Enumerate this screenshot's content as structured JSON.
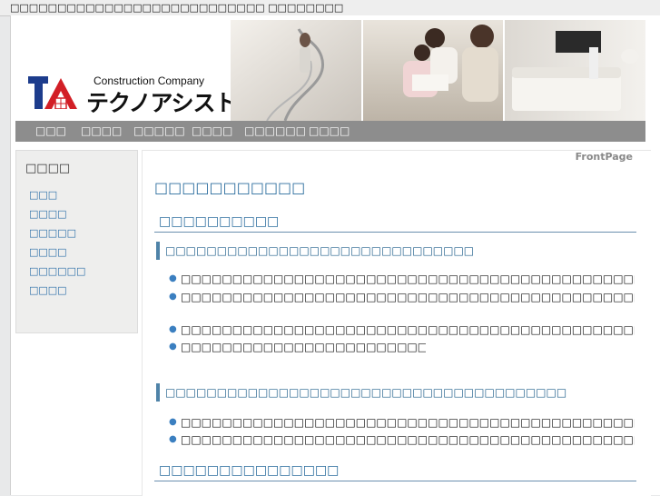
{
  "window": {
    "title": "□□□□□□□□□□□□□□□□□□□□□□□□□□□ □□□□□□□□"
  },
  "header": {
    "logo_en": "Construction Company",
    "logo_jp": "テクノアシスト",
    "colors": {
      "nav_bg": "#8d8d8d",
      "link": "#2a6ea8",
      "heading": "#2b6d9e",
      "logo_red": "#d21f26",
      "logo_blue": "#1d3c8c"
    }
  },
  "nav": {
    "items": [
      "□□□",
      "□□□□",
      "□□□□□",
      "□□□□",
      "□□□□□□",
      "□□□□"
    ]
  },
  "sidebar": {
    "title": "□□□□",
    "items": [
      "□□□",
      "□□□□",
      "□□□□□",
      "□□□□",
      "□□□□□□",
      "□□□□"
    ]
  },
  "content": {
    "frontpage": "FrontPage",
    "title": "□□□□□□□□□□□",
    "section1": {
      "heading": "□□□□□□□□□□",
      "sub1": {
        "heading": "□□□□□□□□□□□□□□□□□□□□□□□□□□□□□□",
        "items": [
          "□□□□□□□□□□□□□□□□□□□□□□□□□□□□□□□□□□□□□□□□□□□□□□□□□□□□□□□□□□□□□□□□□□□□□",
          "□□□□□□□□□□□□□□□□□□□□□□□□□□□□□□□□□□□□□□□□□□□□□□□□□□□□□□□□□□□□□□□□□□□□□□□□□□□□□□□□□□□□□□",
          "□□□□□□□□□□□□□□□□□□□□□□□□□□□□□□□□□□□□□□□□□□□□□□□□□□□□□□□□□□□□□",
          "□□□□□□□□□□□□□□□□□□□□□□□□□□□□□□□□□□□□□□□□□□□□□□□□□□□□□□□□□□□□□□□□□□□□"
        ]
      },
      "sub2": {
        "heading": "□□□□□□□□□□□□□□□□□□□□□□□□□□□□□□□□□□□□□□□",
        "items": [
          "□□□□□□□□□□□□□□□□□□□□□□□□□□□□□□□□□□□□□□□□□□□□□□□□□□□□□□□□□□□□□",
          "□□□□□□□□□□□□□□□□□□□□□□□□□□□□□□□□□□□□□□□□□□□□□"
        ]
      }
    },
    "section2": {
      "heading": "□□□□□□□□□□□□□□□"
    }
  }
}
